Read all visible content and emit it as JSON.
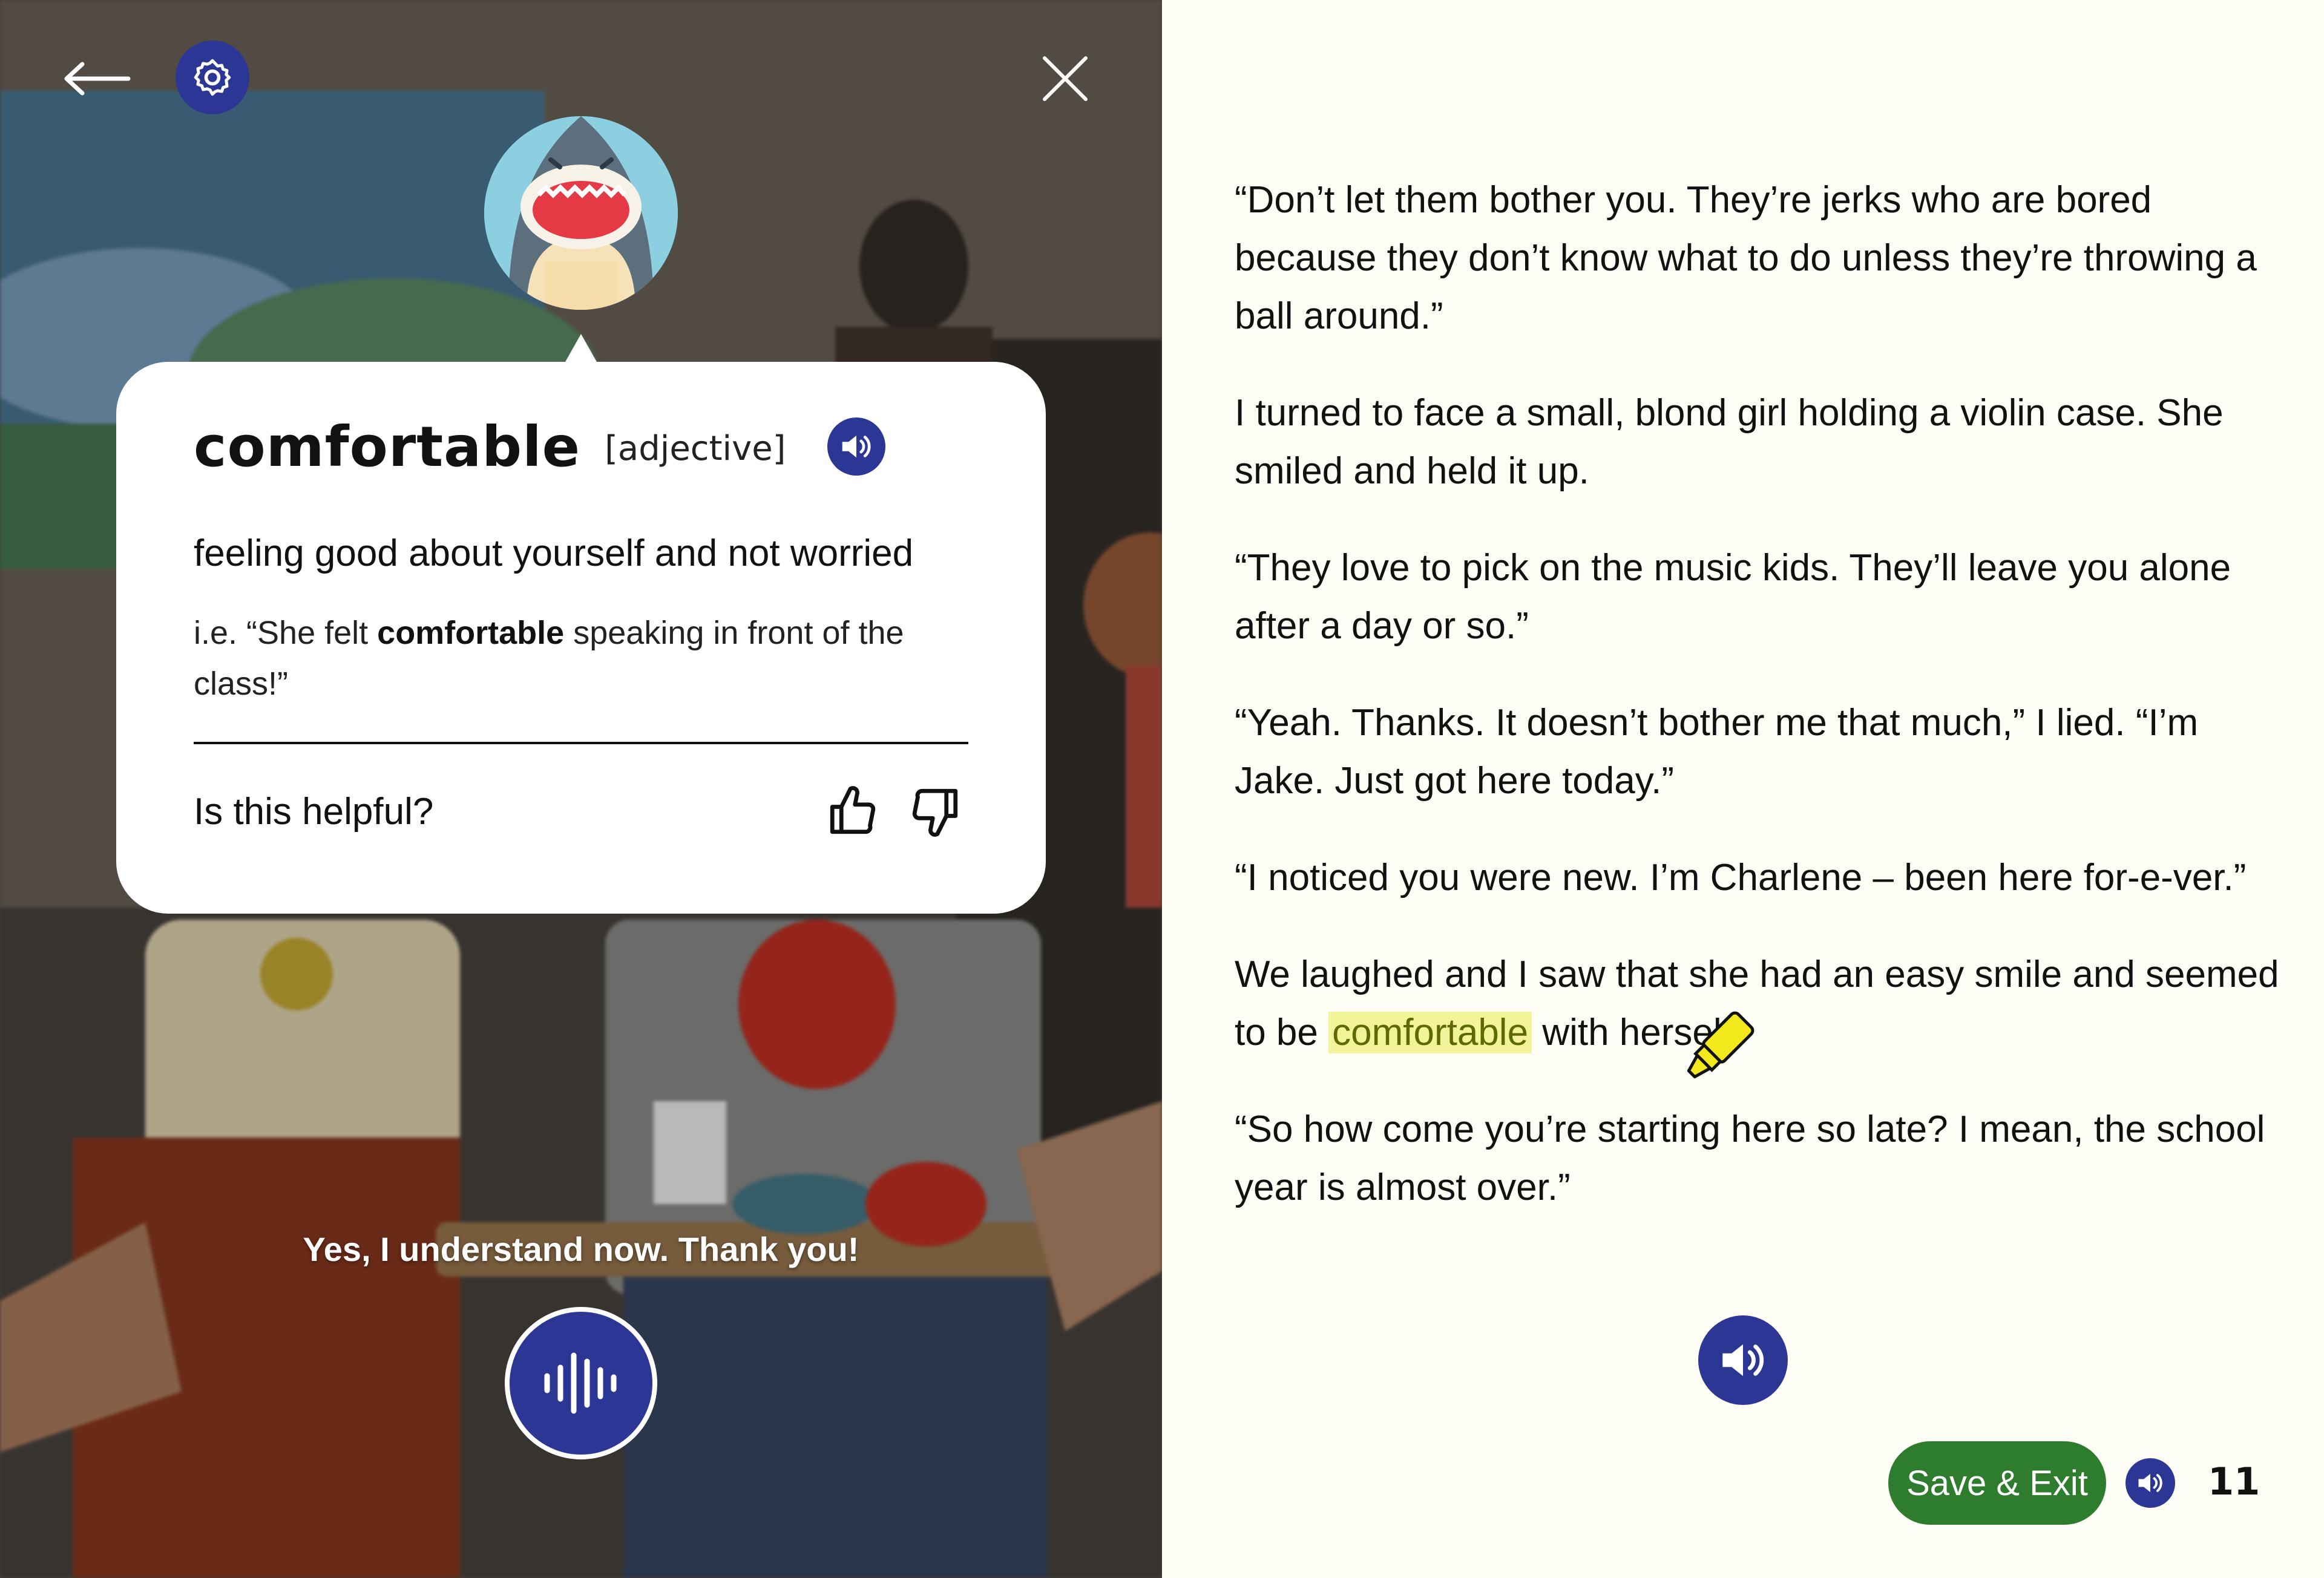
{
  "popup": {
    "word": "comfortable",
    "part_of_speech": "[adjective]",
    "definition": "feeling good about yourself and not worried",
    "example_prefix": "i.e. “She felt ",
    "example_word": "comfortable",
    "example_suffix": " speaking in front of the class!”",
    "helpful_question": "Is this helpful?"
  },
  "response_text": "Yes, I understand now. Thank you!",
  "story": {
    "paragraphs": [
      "“Don’t let them bother you. They’re jerks who are bored because they don’t know what to do unless they’re throwing a ball around.”",
      "I turned to face a small, blond girl holding a violin case. She smiled and held it up.",
      "“They love to pick on the music kids. They’ll leave you alone after a day or so.”",
      "“Yeah. Thanks. It doesn’t bother me that much,” I lied. “I’m Jake. Just got here today.”",
      "“I noticed you were new. I’m Charlene – been here for-e-ver.”"
    ],
    "highlight_para": {
      "before": "We laughed and I saw that she had an easy smile and seemed to be ",
      "highlight": "comfortable",
      "after": " with herself."
    },
    "last_paragraph": "“So how come you’re starting here so late? I mean, the school year is almost over.”"
  },
  "footer": {
    "save_exit_label": "Save & Exit",
    "page_number": "11"
  },
  "icons": {
    "back": "arrow-left-icon",
    "settings": "gear-icon",
    "close": "close-icon",
    "audio": "speaker-icon",
    "mic": "voice-wave-icon",
    "thumbs_up": "thumbs-up-icon",
    "thumbs_down": "thumbs-down-icon",
    "highlighter": "highlighter-icon"
  },
  "colors": {
    "accent_blue": "#2c3795",
    "save_green": "#2e7d2e",
    "highlight_yellow": "#f3f39a",
    "page_bg": "#fefdf6"
  }
}
